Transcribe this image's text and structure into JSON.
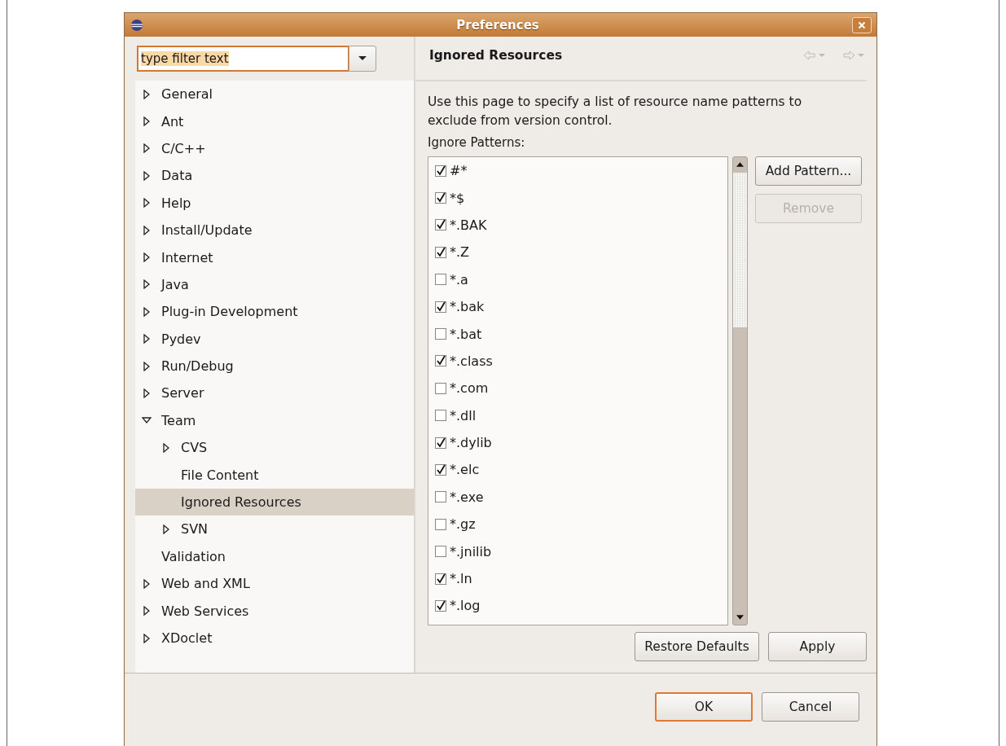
{
  "window": {
    "title": "Preferences"
  },
  "filter": {
    "value": "type filter text"
  },
  "tree": [
    {
      "label": "General",
      "expanded": false,
      "selected": false
    },
    {
      "label": "Ant",
      "expanded": false,
      "selected": false
    },
    {
      "label": "C/C++",
      "expanded": false,
      "selected": false
    },
    {
      "label": "Data",
      "expanded": false,
      "selected": false
    },
    {
      "label": "Help",
      "expanded": false,
      "selected": false
    },
    {
      "label": "Install/Update",
      "expanded": false,
      "selected": false
    },
    {
      "label": "Internet",
      "expanded": false,
      "selected": false
    },
    {
      "label": "Java",
      "expanded": false,
      "selected": false
    },
    {
      "label": "Plug-in Development",
      "expanded": false,
      "selected": false
    },
    {
      "label": "Pydev",
      "expanded": false,
      "selected": false
    },
    {
      "label": "Run/Debug",
      "expanded": false,
      "selected": false
    },
    {
      "label": "Server",
      "expanded": false,
      "selected": false
    },
    {
      "label": "Team",
      "expanded": true,
      "selected": false,
      "children": [
        {
          "label": "CVS",
          "expanded": false,
          "selected": false
        },
        {
          "label": "File Content",
          "selected": false
        },
        {
          "label": "Ignored Resources",
          "selected": true
        },
        {
          "label": "SVN",
          "expanded": false,
          "selected": false
        }
      ]
    },
    {
      "label": "Validation",
      "selected": false
    },
    {
      "label": "Web and XML",
      "expanded": false,
      "selected": false
    },
    {
      "label": "Web Services",
      "expanded": false,
      "selected": false
    },
    {
      "label": "XDoclet",
      "expanded": false,
      "selected": false
    }
  ],
  "page": {
    "title": "Ignored Resources",
    "description": "Use this page to specify a list of resource name patterns to exclude from version control.",
    "list_label": "Ignore Patterns:"
  },
  "patterns": [
    {
      "label": "#*",
      "checked": true
    },
    {
      "label": "*$",
      "checked": true
    },
    {
      "label": "*.BAK",
      "checked": true
    },
    {
      "label": "*.Z",
      "checked": true
    },
    {
      "label": "*.a",
      "checked": false
    },
    {
      "label": "*.bak",
      "checked": true
    },
    {
      "label": "*.bat",
      "checked": false
    },
    {
      "label": "*.class",
      "checked": true
    },
    {
      "label": "*.com",
      "checked": false
    },
    {
      "label": "*.dll",
      "checked": false
    },
    {
      "label": "*.dylib",
      "checked": true
    },
    {
      "label": "*.elc",
      "checked": true
    },
    {
      "label": "*.exe",
      "checked": false
    },
    {
      "label": "*.gz",
      "checked": false
    },
    {
      "label": "*.jnilib",
      "checked": false
    },
    {
      "label": "*.ln",
      "checked": true
    },
    {
      "label": "*.log",
      "checked": true
    }
  ],
  "side_buttons": [
    {
      "label": "Add Pattern...",
      "disabled": false
    },
    {
      "label": "Remove",
      "disabled": true
    }
  ],
  "page_buttons": [
    {
      "label": "Restore Defaults"
    },
    {
      "label": "Apply"
    }
  ],
  "dialog_buttons": [
    {
      "label": "OK",
      "default": true
    },
    {
      "label": "Cancel",
      "default": false
    }
  ]
}
